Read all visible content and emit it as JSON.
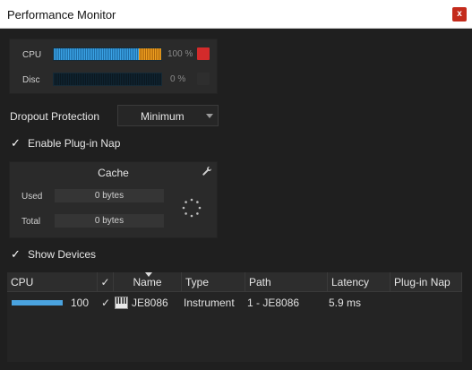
{
  "window": {
    "title": "Performance Monitor",
    "close_label": "x"
  },
  "meters": {
    "cpu": {
      "label": "CPU",
      "percent_text": "100 %",
      "level": 1.0,
      "hot_from": 0.79,
      "led_color": "#d42b2b"
    },
    "disc": {
      "label": "Disc",
      "percent_text": "0 %",
      "level": 0.0,
      "led_color": "#2e2e2e"
    }
  },
  "dropout": {
    "label": "Dropout Protection",
    "value": "Minimum"
  },
  "plugin_nap": {
    "label": "Enable Plug-in Nap",
    "checked": true
  },
  "cache": {
    "title": "Cache",
    "used_label": "Used",
    "used_value": "0 bytes",
    "total_label": "Total",
    "total_value": "0 bytes"
  },
  "show_devices": {
    "label": "Show Devices",
    "checked": true
  },
  "table": {
    "columns": {
      "cpu": "CPU",
      "name": "Name",
      "type": "Type",
      "path": "Path",
      "latency": "Latency",
      "plugin_nap": "Plug-in Nap"
    },
    "rows": [
      {
        "cpu_value": "100",
        "cpu_level": 1.0,
        "enabled": true,
        "name": "JE8086",
        "type": "Instrument",
        "path": "1 - JE8086",
        "latency": "5.9 ms",
        "plugin_nap": ""
      }
    ]
  },
  "icons": [
    "close-icon",
    "wrench-icon",
    "spinner-icon",
    "checkmark-icon",
    "piano-icon",
    "dropdown-arrow-icon",
    "sort-caret-icon"
  ]
}
